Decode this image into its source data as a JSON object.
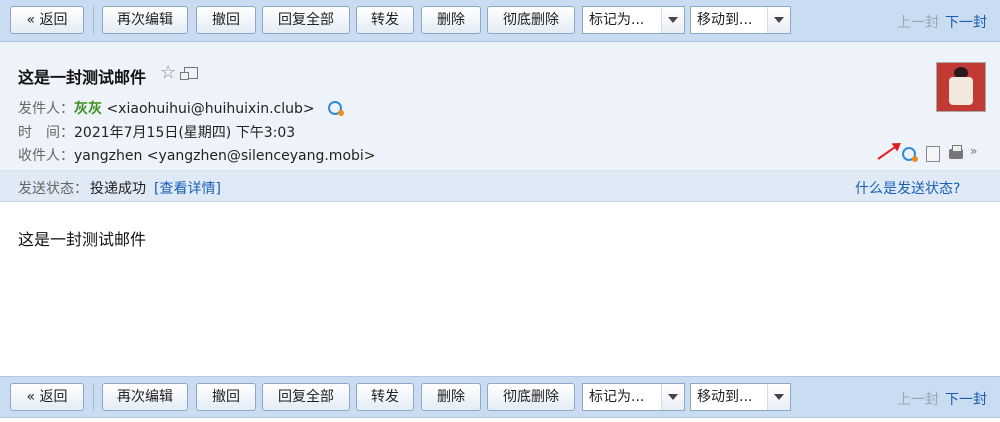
{
  "toolbar": {
    "back": "« 返回",
    "reedit": "再次编辑",
    "recall": "撤回",
    "reply_all": "回复全部",
    "forward": "转发",
    "delete": "删除",
    "delete_permanently": "彻底删除",
    "mark_as": "标记为...",
    "move_to": "移动到...",
    "prev": "上一封",
    "next": "下一封"
  },
  "mail": {
    "subject": "这是一封测试邮件",
    "from_label": "发件人：",
    "from_name": "灰灰",
    "from_addr": "<xiaohuihui@huihuixin.club>",
    "time_label": "时　间：",
    "time_value": "2021年7月15日(星期四) 下午3:03",
    "to_label": "收件人：",
    "to_name": "yangzhen",
    "to_addr": "<yangzhen@silenceyang.mobi>",
    "body": "这是一封测试邮件"
  },
  "status": {
    "label": "发送状态：",
    "value": "投递成功",
    "details_link": "[查看详情]",
    "help_link": "什么是发送状态?"
  },
  "icons": {
    "star": "star-icon",
    "popout": "popout-icon",
    "contact": "contact-icon",
    "print": "print-icon"
  },
  "colors": {
    "toolbar_bg": "#c9dcf1",
    "link": "#1a5fb4",
    "sender_name": "#3a8f1c"
  }
}
